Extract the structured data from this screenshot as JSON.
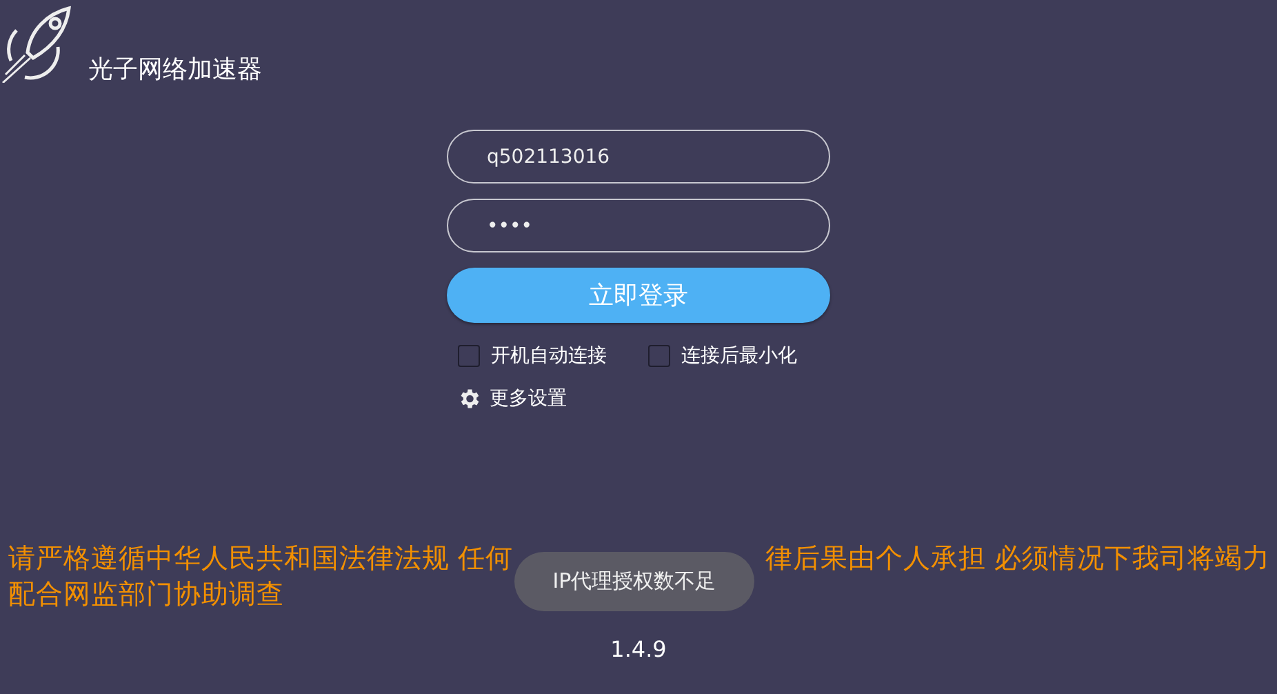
{
  "app": {
    "title": "光子网络加速器"
  },
  "login": {
    "username": "q502113016",
    "password": "••••",
    "submit": "立即登录"
  },
  "options": [
    {
      "label": "开机自动连接",
      "checked": false
    },
    {
      "label": "连接后最小化",
      "checked": false
    }
  ],
  "settings_link": "更多设置",
  "notice": [
    "请严格遵循中华人民共和国法律法规 任何",
    "律后果由个人承担 必须情况下我司将竭力",
    "配合网监部门协助调查"
  ],
  "toast": "IP代理授权数不足",
  "version": "1.4.9"
}
